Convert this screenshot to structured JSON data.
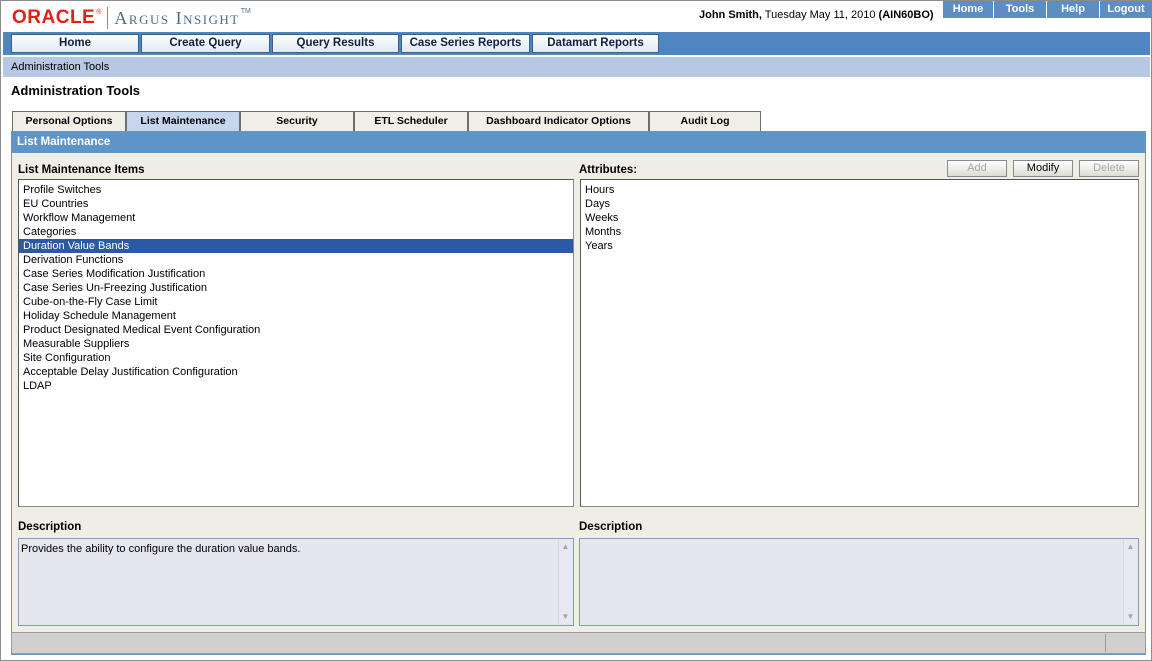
{
  "app": {
    "logo_oracle": "ORACLE",
    "logo_product": "Argus Insight",
    "logo_tm": "TM"
  },
  "header": {
    "user_name": "John Smith,",
    "date": " Tuesday May 11, 2010 ",
    "instance": "(AIN60BO)",
    "links": [
      {
        "label": "Home"
      },
      {
        "label": "Tools"
      },
      {
        "label": "Help"
      },
      {
        "label": "Logout"
      }
    ]
  },
  "nav": {
    "tabs": [
      {
        "label": "Home"
      },
      {
        "label": "Create Query"
      },
      {
        "label": "Query Results"
      },
      {
        "label": "Case Series Reports"
      },
      {
        "label": "Datamart Reports"
      }
    ]
  },
  "breadcrumb": "Administration Tools",
  "page_title": "Administration Tools",
  "sub_tabs": [
    {
      "label": "Personal Options"
    },
    {
      "label": "List Maintenance",
      "active": true
    },
    {
      "label": "Security"
    },
    {
      "label": "ETL Scheduler"
    },
    {
      "label": "Dashboard Indicator Options"
    },
    {
      "label": "Audit Log"
    }
  ],
  "panel": {
    "title": "List Maintenance",
    "items_label": "List Maintenance Items",
    "attributes_label": "Attributes:",
    "buttons": {
      "add": "Add",
      "modify": "Modify",
      "delete": "Delete"
    },
    "items": [
      "Profile Switches",
      "EU Countries",
      "Workflow Management",
      "Categories",
      "Duration Value Bands",
      "Derivation Functions",
      "Case Series Modification Justification",
      "Case Series Un-Freezing Justification",
      "Cube-on-the-Fly Case Limit",
      "Holiday Schedule Management",
      "Product Designated Medical Event Configuration",
      "Measurable Suppliers",
      "Site Configuration",
      "Acceptable Delay Justification Configuration",
      "LDAP"
    ],
    "selected_item": "Duration Value Bands",
    "attributes": [
      "Hours",
      "Days",
      "Weeks",
      "Months",
      "Years"
    ],
    "left_description_label": "Description",
    "left_description": "Provides the ability to configure the duration value bands.",
    "right_description_label": "Description",
    "right_description": ""
  },
  "colors": {
    "oracle_red": "#e41f16",
    "nav_blue": "#4f86c0",
    "selection_blue": "#2a5aa6",
    "panel_bg": "#eeeee4"
  }
}
